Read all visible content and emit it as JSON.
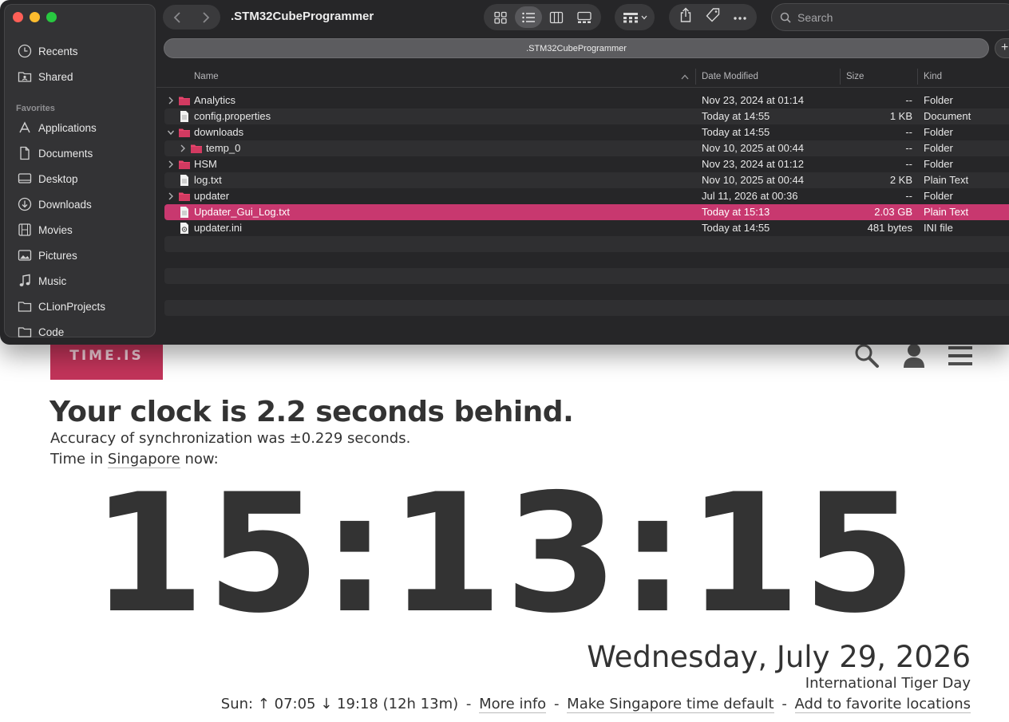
{
  "web": {
    "logo": "TIME.IS",
    "headline": "Your clock is 2.2 seconds behind.",
    "accuracy": "Accuracy of synchronization was ±0.229 seconds.",
    "time_in_prefix": "Time in",
    "city": "Singapore",
    "time_in_suffix": "now:",
    "clock": "15:13:15",
    "date": "Wednesday, July 29, 2026",
    "holiday": "International Tiger Day",
    "sun_text": "Sun: ↑ 07:05 ↓ 19:18 (12h 13m)",
    "more_info": "More info",
    "make_default": "Make Singapore time default",
    "add_favorite": "Add to favorite locations",
    "separator": "-"
  },
  "finder": {
    "title": ".STM32CubeProgrammer",
    "path_tab": ".STM32CubeProgrammer",
    "add_tab": "+",
    "search_placeholder": "Search",
    "sidebar": {
      "top_items": [
        {
          "label": "Recents",
          "icon": "clock-icon"
        },
        {
          "label": "Shared",
          "icon": "shared-folder-icon"
        }
      ],
      "favorites_title": "Favorites",
      "favorites": [
        {
          "label": "Applications",
          "icon": "applications-icon"
        },
        {
          "label": "Documents",
          "icon": "document-icon"
        },
        {
          "label": "Desktop",
          "icon": "desktop-icon"
        },
        {
          "label": "Downloads",
          "icon": "download-icon"
        },
        {
          "label": "Movies",
          "icon": "film-icon"
        },
        {
          "label": "Pictures",
          "icon": "photo-icon"
        },
        {
          "label": "Music",
          "icon": "music-note-icon"
        },
        {
          "label": "CLionProjects",
          "icon": "folder-icon"
        },
        {
          "label": "Code",
          "icon": "folder-icon"
        }
      ]
    },
    "columns": {
      "name": "Name",
      "date": "Date Modified",
      "size": "Size",
      "kind": "Kind"
    },
    "files": [
      {
        "name": "Analytics",
        "date": "Nov 23, 2024 at 01:14",
        "size": "--",
        "kind": "Folder",
        "type": "folder",
        "expand": "collapsed",
        "indent": 0
      },
      {
        "name": "config.properties",
        "date": "Today at 14:55",
        "size": "1 KB",
        "kind": "Document",
        "type": "doc",
        "expand": "none",
        "indent": 0
      },
      {
        "name": "downloads",
        "date": "Today at 14:55",
        "size": "--",
        "kind": "Folder",
        "type": "folder",
        "expand": "expanded",
        "indent": 0
      },
      {
        "name": "temp_0",
        "date": "Nov 10, 2025 at 00:44",
        "size": "--",
        "kind": "Folder",
        "type": "folder",
        "expand": "collapsed",
        "indent": 1
      },
      {
        "name": "HSM",
        "date": "Nov 23, 2024 at 01:12",
        "size": "--",
        "kind": "Folder",
        "type": "folder",
        "expand": "collapsed",
        "indent": 0
      },
      {
        "name": "log.txt",
        "date": "Nov 10, 2025 at 00:44",
        "size": "2 KB",
        "kind": "Plain Text",
        "type": "doc",
        "expand": "none",
        "indent": 0
      },
      {
        "name": "updater",
        "date": "Jul 11, 2026 at 00:36",
        "size": "--",
        "kind": "Folder",
        "type": "folder",
        "expand": "collapsed",
        "indent": 0
      },
      {
        "name": "Updater_Gui_Log.txt",
        "date": "Today at 15:13",
        "size": "2.03 GB",
        "kind": "Plain Text",
        "type": "doc",
        "expand": "none",
        "indent": 0,
        "selected": true
      },
      {
        "name": "updater.ini",
        "date": "Today at 14:55",
        "size": "481 bytes",
        "kind": "INI file",
        "type": "ini",
        "expand": "none",
        "indent": 0
      }
    ],
    "colors": {
      "selection": "#c8386f",
      "folder": "#e8456d",
      "window_bg": "#262628"
    }
  }
}
